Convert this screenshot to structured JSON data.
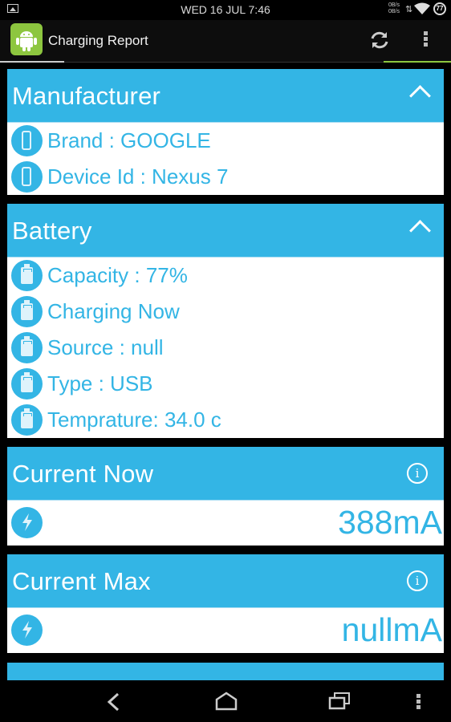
{
  "status_bar": {
    "clock": "WED 16 JUL 7:46",
    "net_up": "0B/s",
    "net_down": "0B/s",
    "battery_level": "77"
  },
  "app_bar": {
    "title": "Charging Report",
    "refresh_icon": "refresh-icon",
    "overflow_icon": "overflow-menu-icon",
    "accent": "#8dc63f"
  },
  "theme": {
    "primary": "#33b5e5"
  },
  "cards": {
    "manufacturer": {
      "title": "Manufacturer",
      "items": [
        "Brand : GOOGLE",
        "Device Id : Nexus 7"
      ]
    },
    "battery": {
      "title": "Battery",
      "items": [
        "Capacity : 77%",
        "Charging Now",
        "Source : null",
        "Type : USB",
        "Temprature: 34.0 c"
      ]
    },
    "current_now": {
      "title": "Current Now",
      "value": "388mA"
    },
    "current_max": {
      "title": "Current Max",
      "value": "nullmA"
    }
  },
  "nav_bar": {
    "back": "back-icon",
    "home": "home-icon",
    "recents": "recents-icon",
    "menu": "menu-icon"
  }
}
